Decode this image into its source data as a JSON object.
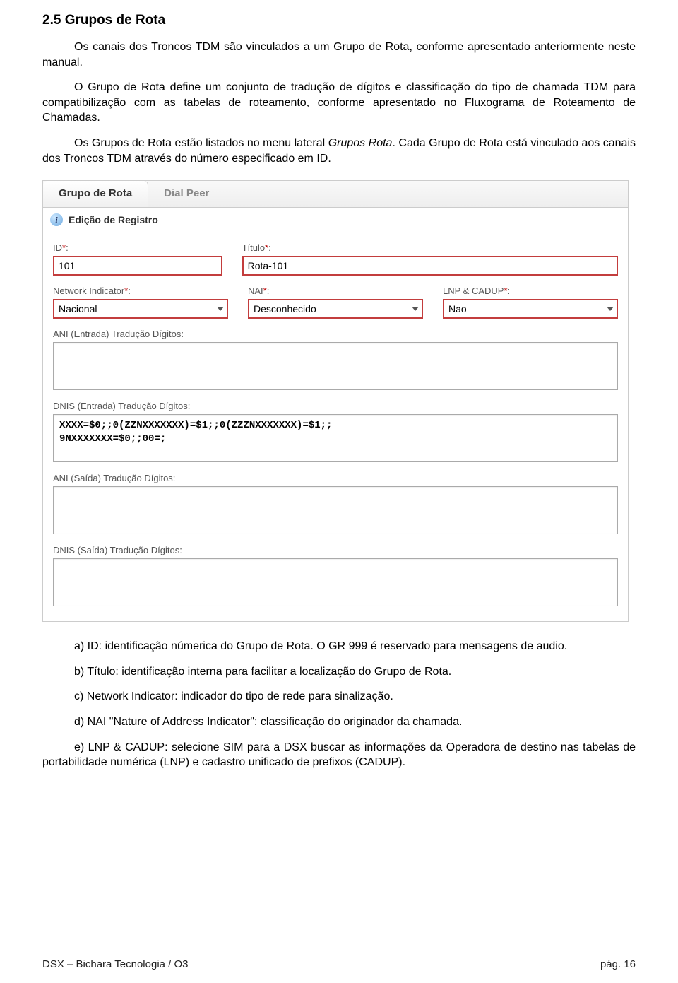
{
  "section_title": "2.5 Grupos de Rota",
  "p1": "Os canais dos Troncos TDM são vinculados a um Grupo de Rota, conforme apresentado anteriormente neste manual.",
  "p2": "O Grupo de Rota define um conjunto de tradução de dígitos e classificação do tipo de chamada TDM para compatibilização com as tabelas de roteamento, conforme apresentado no Fluxograma de Roteamento de Chamadas.",
  "p3a": "Os Grupos de Rota estão listados no menu lateral ",
  "p3b": "Grupos Rota",
  "p3c": ". Cada Grupo de Rota está vinculado aos canais dos Troncos TDM através do número especificado em ID.",
  "ui": {
    "tab_active": "Grupo de Rota",
    "tab_inactive": "Dial Peer",
    "reg_title": "Edição de Registro",
    "labels": {
      "id": "ID",
      "titulo": "Título",
      "ni": "Network Indicator",
      "nai": "NAI",
      "lnp": "LNP & CADUP",
      "ani_in": "ANI (Entrada) Tradução Dígitos:",
      "dnis_in": "DNIS (Entrada) Tradução Dígitos:",
      "ani_out": "ANI (Saída) Tradução Dígitos:",
      "dnis_out": "DNIS (Saída) Tradução Dígitos:"
    },
    "values": {
      "id": "101",
      "titulo": "Rota-101",
      "ni": "Nacional",
      "nai": "Desconhecido",
      "lnp": "Nao",
      "ani_in": "",
      "dnis_in": "XXXX=$0;;0(ZZNXXXXXXX)=$1;;0(ZZZNXXXXXXX)=$1;;\n9NXXXXXXX=$0;;00=;",
      "ani_out": "",
      "dnis_out": ""
    },
    "star": "*",
    "colon": ":"
  },
  "lista": {
    "a": "a) ID: identificação númerica do Grupo de Rota. O GR 999 é reservado para mensagens de audio.",
    "b": "b) Título: identificação interna para facilitar a localização do Grupo de Rota.",
    "c": "c) Network Indicator: indicador do tipo de rede para sinalização.",
    "d": "d) NAI \"Nature of Address Indicator\": classificação do originador da chamada.",
    "e": "e) LNP & CADUP: selecione SIM para a DSX buscar as informações da Operadora de destino nas tabelas de portabilidade numérica (LNP) e cadastro unificado de prefixos (CADUP)."
  },
  "footer": {
    "left": "DSX – Bichara Tecnologia / O3",
    "right": "pág. 16"
  }
}
